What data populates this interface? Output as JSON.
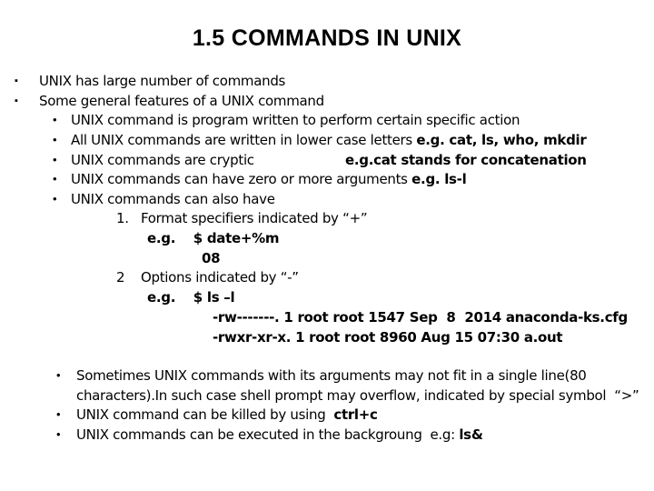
{
  "title": "1.5 COMMANDS IN UNIX",
  "top_bullets": [
    {
      "bullet": "▪",
      "text": "UNIX has large number of commands"
    },
    {
      "bullet": "▪",
      "text": "Some general features of a UNIX command"
    }
  ],
  "features": [
    {
      "bullet": "•",
      "text": "UNIX command is program written to perform certain specific action",
      "bold": ""
    },
    {
      "bullet": "•",
      "text": "All UNIX commands are written in lower case letters ",
      "bold": "e.g. cat, ls, who, mkdir"
    },
    {
      "bullet": "•",
      "text": "UNIX commands are cryptic",
      "bold": "e.g.cat stands for concatenation"
    },
    {
      "bullet": "•",
      "text": "UNIX commands can have zero or more arguments ",
      "bold": "e.g. ls-l"
    },
    {
      "bullet": "•",
      "text": "UNIX commands can also have",
      "bold": ""
    }
  ],
  "sub_items": {
    "item1": {
      "number": "1.",
      "text": "Format specifiers indicated by “+”"
    },
    "item1_example": "e.g.    $ date+%m",
    "item1_output": "08",
    "item2": {
      "number": "2",
      "text": "Options indicated by “-”"
    },
    "item2_example": "e.g.    $ ls –l",
    "item2_output": [
      "-rw-------. 1 root root 1547 Sep  8  2014 anaconda-ks.cfg",
      "-rwxr-xr-x. 1 root root 8960 Aug 15 07:30 a.out"
    ]
  },
  "bottom_bullets": [
    {
      "bullet": "•",
      "text": "Sometimes UNIX commands with its arguments may not fit in a single line(80",
      "cont": "characters).In such case shell prompt may overflow, indicated by special symbol  “>”"
    },
    {
      "bullet": "•",
      "text": "UNIX command can be killed by using  ",
      "bold": "ctrl+c"
    },
    {
      "bullet": "•",
      "text": "UNIX commands can be executed in the backgroung  e.g: ",
      "bold": "ls&"
    }
  ]
}
